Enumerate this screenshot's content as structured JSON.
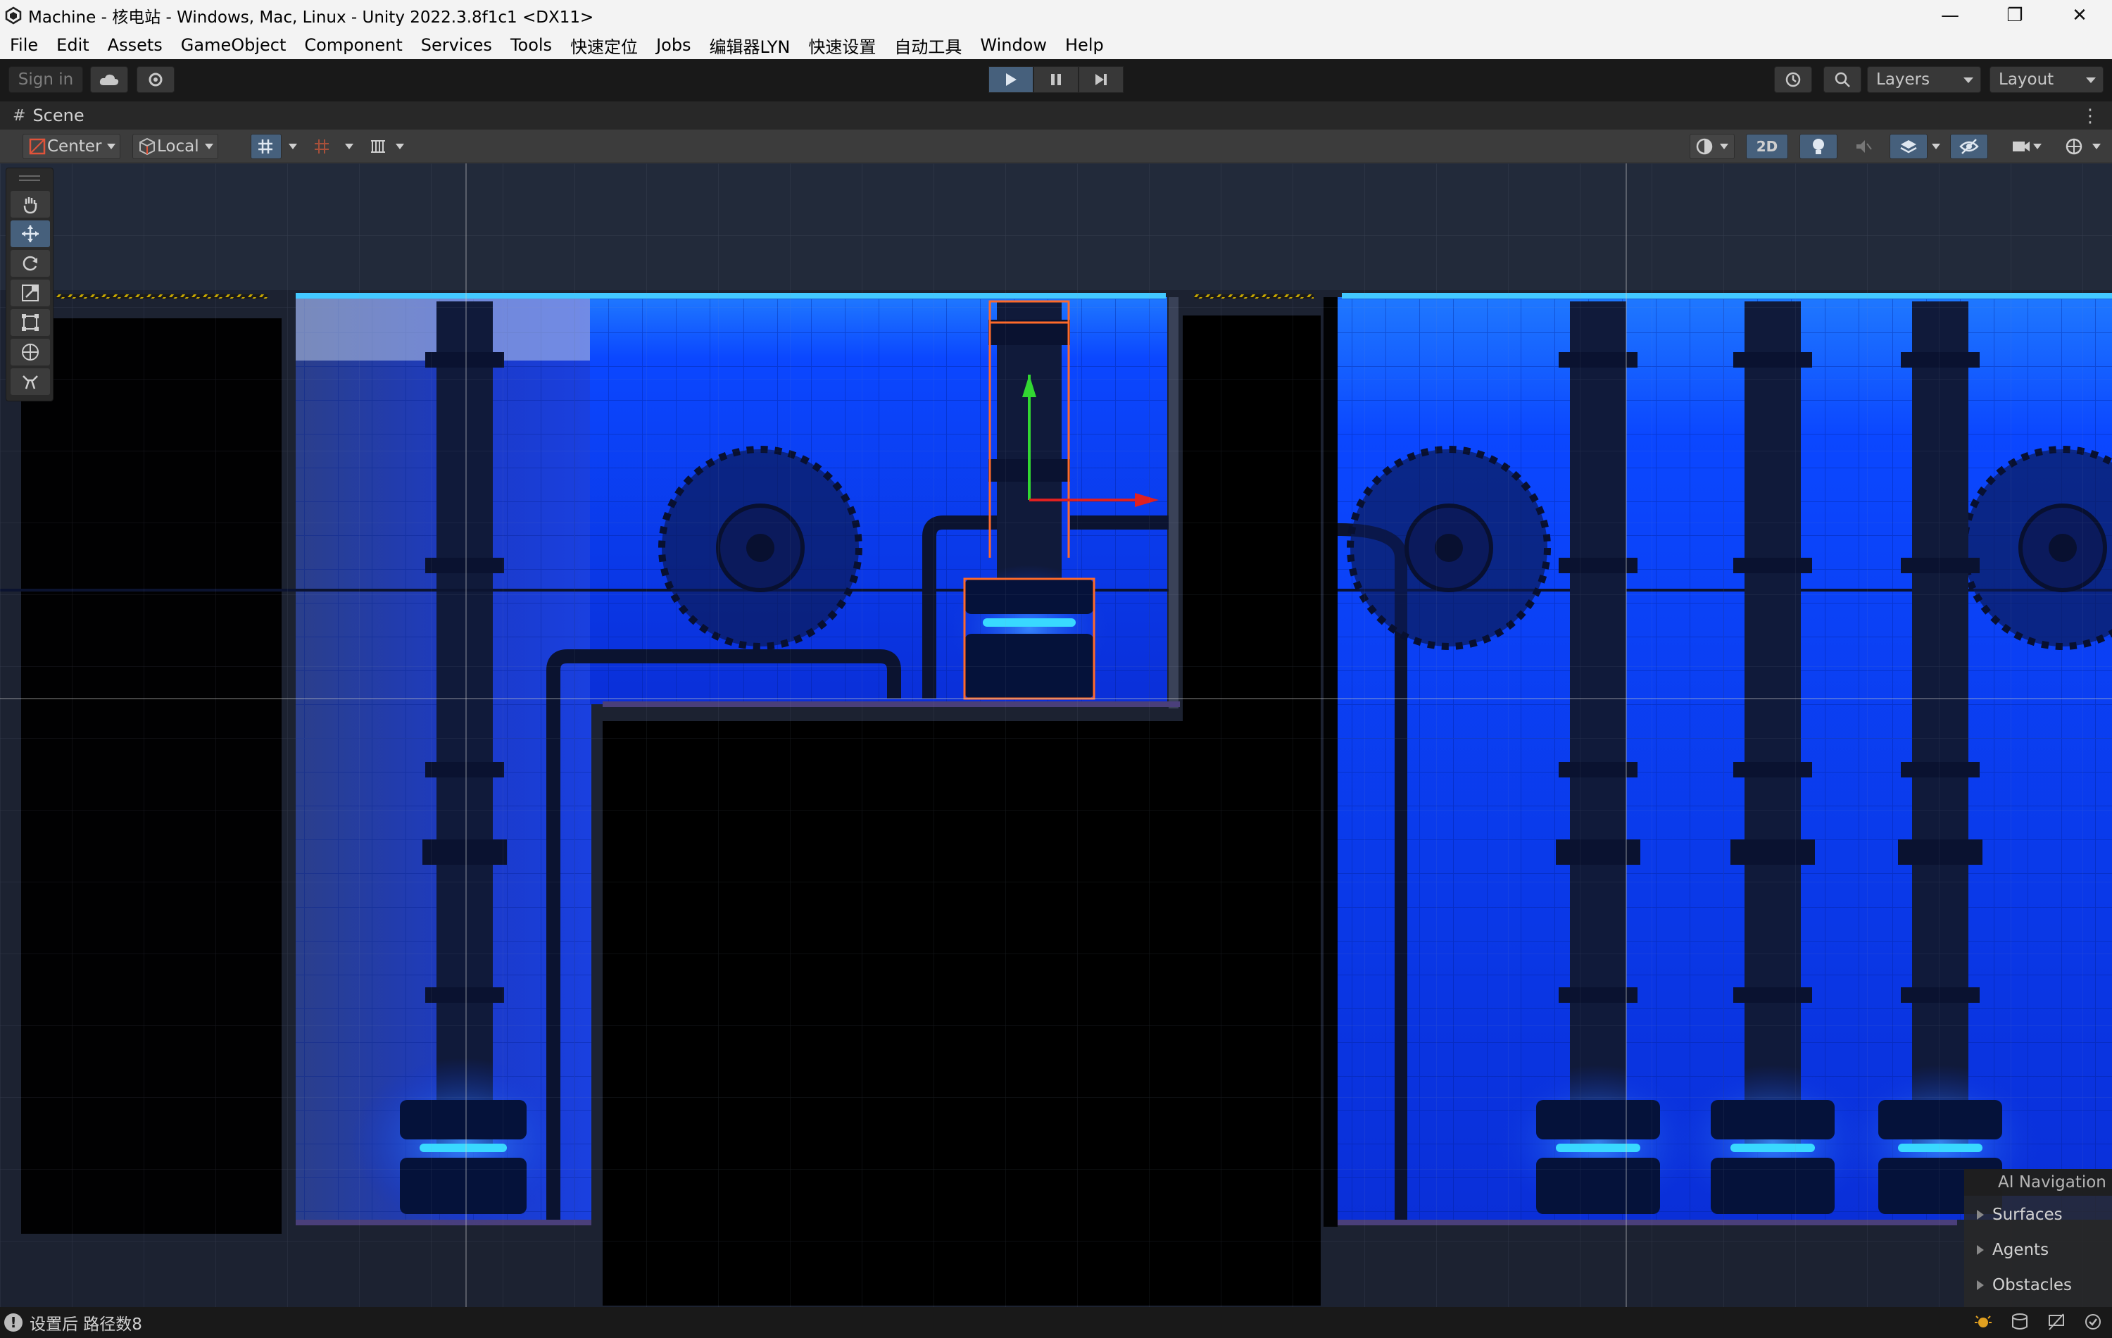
{
  "window": {
    "title": "Machine - 核电站 - Windows, Mac, Linux - Unity 2022.3.8f1c1 <DX11>",
    "minimize_icon": "minimize-icon",
    "maximize_icon": "restore-icon",
    "close_icon": "close-icon"
  },
  "menu": [
    "File",
    "Edit",
    "Assets",
    "GameObject",
    "Component",
    "Services",
    "Tools",
    "快速定位",
    "Jobs",
    "编辑器LYN",
    "快速设置",
    "自动工具",
    "Window",
    "Help"
  ],
  "toolbar": {
    "sign_in": "Sign in",
    "layers": "Layers",
    "layout": "Layout"
  },
  "scene_tab": {
    "label": "Scene"
  },
  "scene_toolbar": {
    "pivot": "Center",
    "space": "Local",
    "mode_2d": "2D"
  },
  "tools": [
    "hand-tool",
    "move-tool",
    "rotate-tool",
    "scale-tool",
    "rect-tool",
    "transform-tool",
    "custom-tool"
  ],
  "ai_navigation": {
    "title": "AI Navigation",
    "items": [
      "Surfaces",
      "Agents",
      "Obstacles"
    ]
  },
  "status": {
    "message": "设置后 路径数8"
  },
  "colors": {
    "accent": "#46607c",
    "scene_blue": "#0a3cff",
    "selection_outline": "#ff6a2a",
    "gizmo_y": "#32d732",
    "gizmo_x": "#e02020"
  }
}
